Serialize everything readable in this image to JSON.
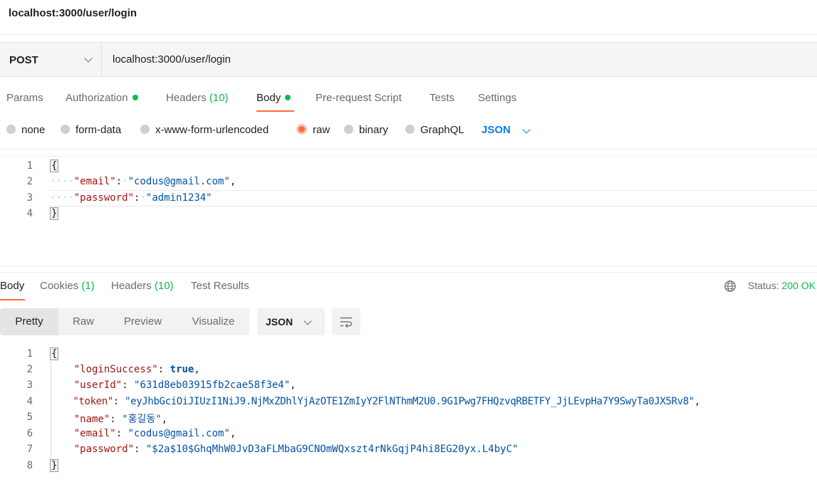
{
  "page_title": "localhost:3000/user/login",
  "request": {
    "method": "POST",
    "url": "localhost:3000/user/login"
  },
  "request_tabs": {
    "params": "Params",
    "authorization": "Authorization",
    "headers": "Headers",
    "headers_count": "(10)",
    "body": "Body",
    "pre_request": "Pre-request Script",
    "tests": "Tests",
    "settings": "Settings"
  },
  "body_types": {
    "none": "none",
    "form_data": "form-data",
    "urlencoded": "x-www-form-urlencoded",
    "raw": "raw",
    "binary": "binary",
    "graphql": "GraphQL",
    "format": "JSON"
  },
  "request_body": {
    "line_numbers": [
      "1",
      "2",
      "3",
      "4"
    ],
    "open": "{",
    "close": "}",
    "email_key": "\"email\"",
    "email_value": "\"codus@gmail.com\"",
    "password_key": "\"password\"",
    "password_value": "\"admin1234\""
  },
  "response_tabs": {
    "body": "Body",
    "cookies": "Cookies",
    "cookies_count": "(1)",
    "headers": "Headers",
    "headers_count": "(10)",
    "test_results": "Test Results"
  },
  "status": {
    "label": "Status:",
    "value": "200 OK"
  },
  "view_modes": {
    "pretty": "Pretty",
    "raw": "Raw",
    "preview": "Preview",
    "visualize": "Visualize",
    "format": "JSON"
  },
  "response_body": {
    "line_numbers": [
      "1",
      "2",
      "3",
      "4",
      "5",
      "6",
      "7",
      "8"
    ],
    "open": "{",
    "close": "}",
    "loginSuccess_key": "\"loginSuccess\"",
    "loginSuccess_value": "true",
    "userId_key": "\"userId\"",
    "userId_value": "\"631d8eb03915fb2cae58f3e4\"",
    "token_key": "\"token\"",
    "token_value": "\"eyJhbGciOiJIUzI1NiJ9.NjMxZDhlYjAzOTE1ZmIyY2FlNThmM2U0.9G1Pwg7FHQzvqRBETFY_JjLEvpHa7Y9SwyTa0JX5Rv8\"",
    "name_key": "\"name\"",
    "name_value": "\"홍길동\"",
    "email_key": "\"email\"",
    "email_value": "\"codus@gmail.com\"",
    "password_key": "\"password\"",
    "password_value": "\"$2a$10$GhqMhW0JvD3aFLMbaG9CNOmWQxszt4rNkGqjP4hi8EG20yx.L4byC\""
  },
  "colors": {
    "accent": "#ff6c37",
    "success": "#0cbb52",
    "link": "#097bed"
  },
  "icons": [
    "chevron-down-icon",
    "globe-icon",
    "wrap-lines-icon"
  ]
}
